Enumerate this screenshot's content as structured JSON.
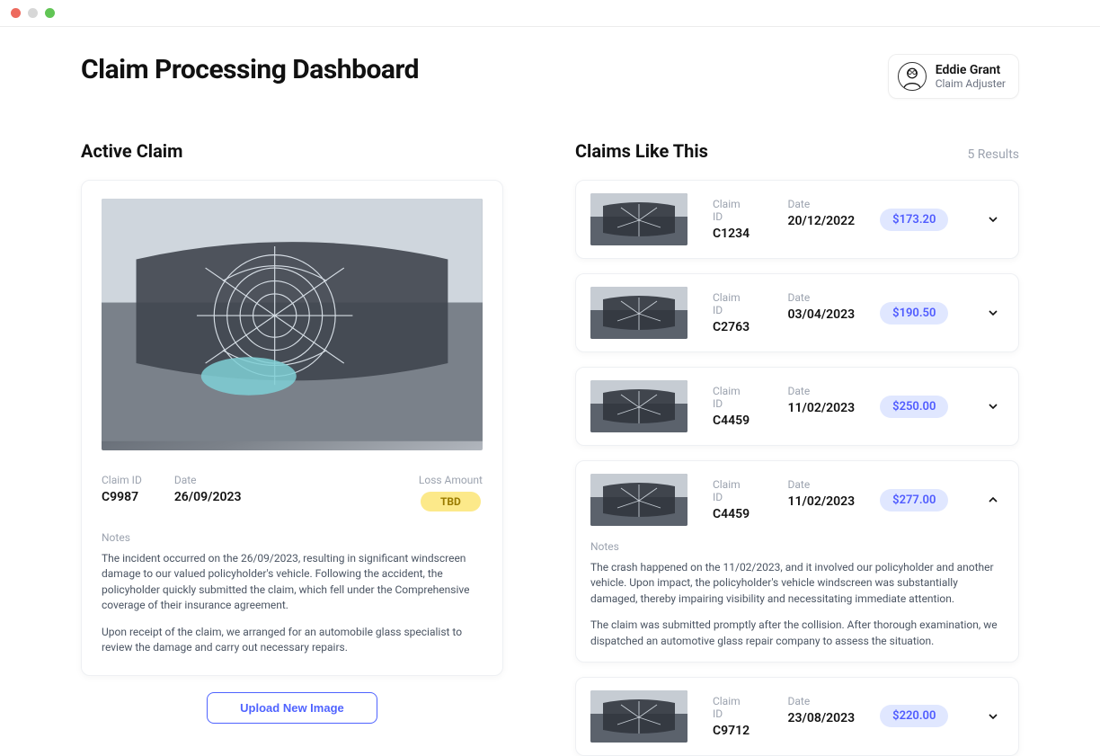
{
  "header": {
    "title": "Claim Processing Dashboard",
    "user_name": "Eddie Grant",
    "user_role": "Claim Adjuster"
  },
  "active": {
    "section_title": "Active Claim",
    "claim_id_label": "Claim ID",
    "claim_id": "C9987",
    "date_label": "Date",
    "date": "26/09/2023",
    "loss_label": "Loss Amount",
    "loss_value": "TBD",
    "notes_label": "Notes",
    "notes_p1": "The incident occurred on the 26/09/2023, resulting in significant windscreen damage to our valued policyholder's vehicle. Following the accident, the policyholder quickly submitted the claim, which fell under the Comprehensive coverage of their insurance agreement.",
    "notes_p2": "Upon receipt of the claim, we arranged for an automobile glass specialist to review the damage and carry out necessary repairs.",
    "upload_label": "Upload New Image"
  },
  "similar": {
    "section_title": "Claims Like This",
    "results_text": "5 Results",
    "claim_id_label": "Claim ID",
    "date_label": "Date",
    "notes_label": "Notes",
    "items": [
      {
        "claim_id": "C1234",
        "date": "20/12/2022",
        "amount": "$173.20",
        "expanded": false
      },
      {
        "claim_id": "C2763",
        "date": "03/04/2023",
        "amount": "$190.50",
        "expanded": false
      },
      {
        "claim_id": "C4459",
        "date": "11/02/2023",
        "amount": "$250.00",
        "expanded": false
      },
      {
        "claim_id": "C4459",
        "date": "11/02/2023",
        "amount": "$277.00",
        "expanded": true,
        "notes_p1": "The crash happened on the 11/02/2023, and it involved our policyholder and another vehicle. Upon impact, the policyholder's vehicle windscreen was substantially damaged, thereby impairing visibility and necessitating immediate attention.",
        "notes_p2": "The claim was submitted promptly after the collision. After thorough examination, we dispatched an automotive glass repair company to assess the situation."
      },
      {
        "claim_id": "C9712",
        "date": "23/08/2023",
        "amount": "$220.00",
        "expanded": false
      }
    ]
  }
}
